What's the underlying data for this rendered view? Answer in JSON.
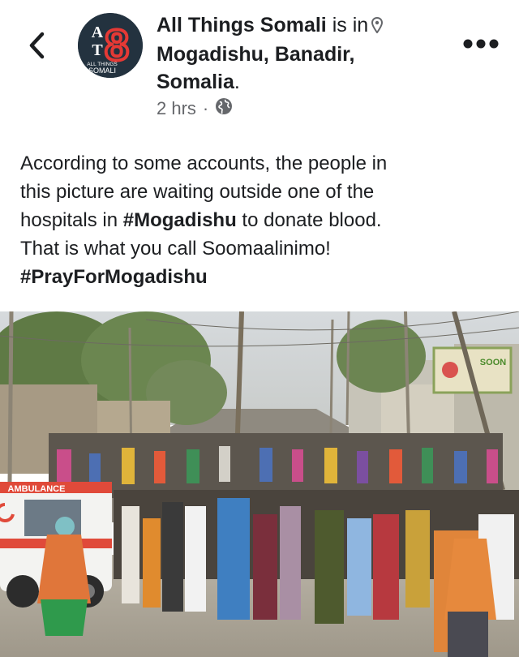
{
  "header": {
    "page_name": "All Things Somali",
    "is_in": "is in",
    "location": "Mogadishu, Banadir, Somalia",
    "location_line1": "Mogadishu, Banadir,",
    "location_line2": "Somalia",
    "period": ".",
    "time": "2 hrs",
    "separator": "·",
    "privacy_icon": "globe-icon"
  },
  "avatar": {
    "letters_top": "A",
    "letters_bottom": "T",
    "number": "8",
    "caption_line1": "ALL THINGS",
    "caption_line2": "SOMALI",
    "colors": {
      "background": "#23323f",
      "accent": "#e53935"
    }
  },
  "post": {
    "text_line1": "According to some accounts, the people in",
    "text_line2": "this picture are waiting outside one of the",
    "text_line3a": "hospitals in ",
    "hashtag1": "#Mogadishu",
    "text_line3b": " to donate blood.",
    "text_line4": "That is what you call Soomaalinimo!",
    "hashtag2": "#PrayForMogadishu"
  },
  "photo": {
    "ambulance_text": "AMBULANCE",
    "billboard_text": "SOON"
  },
  "icons": {
    "back": "chevron-left-icon",
    "more": "more-options-icon",
    "pin": "location-pin-icon"
  },
  "colors": {
    "text": "#1c1e21",
    "secondary": "#65676b",
    "sky": "#d9dde0"
  }
}
